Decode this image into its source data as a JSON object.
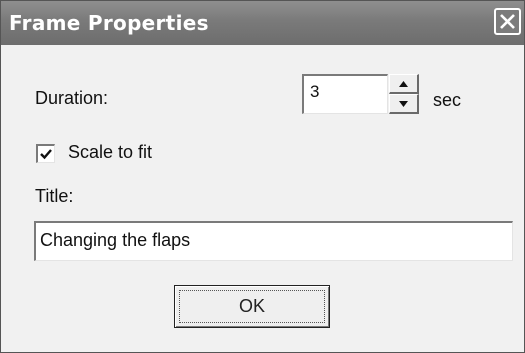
{
  "window": {
    "title": "Frame Properties",
    "close_icon": "close-icon"
  },
  "duration": {
    "label": "Duration:",
    "value": "3",
    "unit": "sec",
    "spin_up_icon": "triangle-up-icon",
    "spin_down_icon": "triangle-down-icon"
  },
  "scale_to_fit": {
    "label": "Scale to fit",
    "checked": true
  },
  "title_field": {
    "label": "Title:",
    "value": "Changing the flaps"
  },
  "buttons": {
    "ok_label": "OK"
  },
  "colors": {
    "titlebar": "#7a7a7a",
    "dialog_background": "#f1f1f1",
    "title_text": "#ffffff"
  }
}
